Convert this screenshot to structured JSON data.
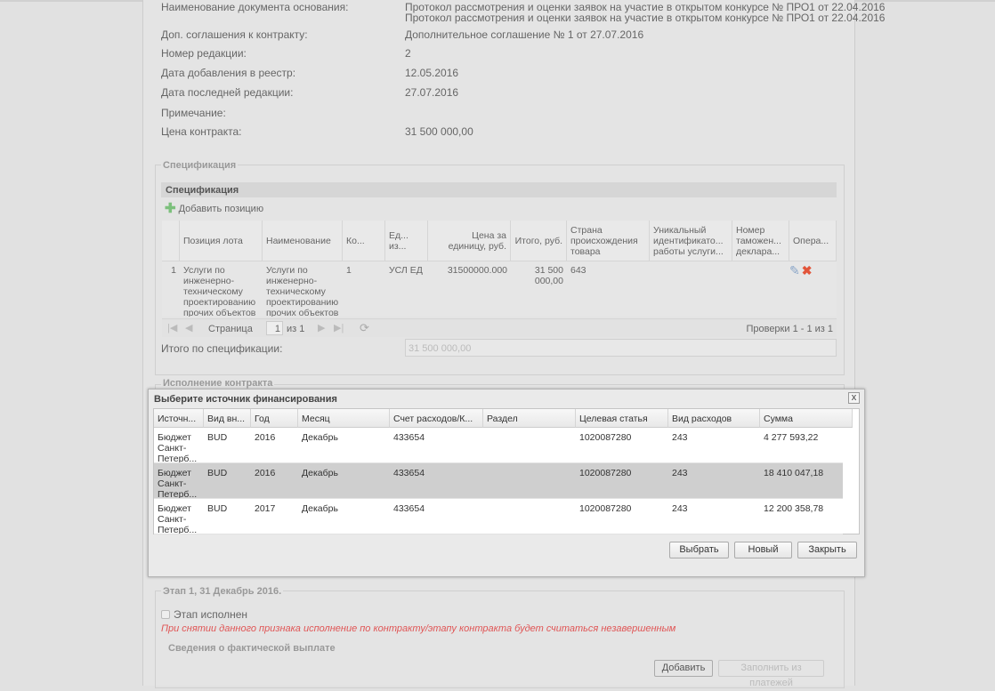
{
  "details": [
    {
      "label": "Наименование документа основания:",
      "value": [
        "Протокол рассмотрения и оценки заявок на участие в открытом конкурсе № ПРО1 от 22.04.2016",
        "Протокол рассмотрения и оценки заявок на участие в открытом конкурсе № ПРО1 от 22.04.2016"
      ]
    },
    {
      "label": "Доп. соглашения к контракту:",
      "value": [
        "Дополнительное соглашение № 1 от 27.07.2016"
      ]
    },
    {
      "label": "Номер редакции:",
      "value": [
        "2"
      ]
    },
    {
      "label": "Дата добавления в реестр:",
      "value": [
        "12.05.2016"
      ]
    },
    {
      "label": "Дата последней редакции:",
      "value": [
        "27.07.2016"
      ]
    },
    {
      "label": "Примечание:",
      "value": [
        ""
      ]
    },
    {
      "label": "Цена контракта:",
      "value": [
        "31 500 000,00"
      ]
    }
  ],
  "spec": {
    "legend": "Спецификация",
    "title": "Спецификация",
    "add_label": "Добавить позицию",
    "columns": [
      "",
      "Позиция лота",
      "Наименование",
      "Ко...",
      "Ед... из...",
      "Цена за единицу, руб.",
      "Итого, руб.",
      "Страна происхождения товара",
      "Уникальный идентификато... работы услуги...",
      "Номер таможен... деклара...",
      "Опера..."
    ],
    "rows": [
      [
        "1",
        "Услуги по инженерно-техническому проектированию прочих объектов",
        "Услуги по инженерно-техническому проектированию прочих объектов",
        "1",
        "УСЛ ЕД",
        "31500000.000",
        "31 500 000,00",
        "643",
        "",
        ""
      ]
    ],
    "pager": {
      "page_label": "Страница",
      "page": "1",
      "of": "из 1",
      "summary": "Проверки 1 - 1 из 1"
    },
    "total_label": "Итого по спецификации:",
    "total_value": "31 500 000,00"
  },
  "execution": {
    "legend": "Исполнение контракта"
  },
  "dialog": {
    "title": "Выберите источник финансирования",
    "close": "x",
    "columns": [
      "Источн...",
      "Вид вн...",
      "Год",
      "Месяц",
      "Счет расходов/К...",
      "Раздел",
      "Целевая статья",
      "Вид расходов",
      "Сумма"
    ],
    "rows": [
      [
        "Бюджет Санкт-Петерб...",
        "BUD",
        "2016",
        "Декабрь",
        "433654",
        "",
        "1020087280",
        "243",
        "4 277 593,22"
      ],
      [
        "Бюджет Санкт-Петерб...",
        "BUD",
        "2016",
        "Декабрь",
        "433654",
        "",
        "1020087280",
        "243",
        "18 410 047,18"
      ],
      [
        "Бюджет Санкт-Петерб...",
        "BUD",
        "2017",
        "Декабрь",
        "433654",
        "",
        "1020087280",
        "243",
        "12 200 358,78"
      ]
    ],
    "selected_row": 1,
    "buttons": {
      "select": "Выбрать",
      "new": "Новый",
      "close": "Закрыть"
    }
  },
  "stage": {
    "legend": "Этап 1, 31 Декабрь 2016.",
    "checkbox_label": "Этап исполнен",
    "checked": false,
    "warning": "При снятии данного признака исполнение по контракту/этапу контракта будет считаться незавершенным",
    "payments_title": "Сведения о фактической выплате",
    "add_label": "Добавить",
    "fill_label": "Заполнить из платежей"
  },
  "colors": {
    "warning": "#e05555",
    "selected_row": "#cfcfcf",
    "add_icon": "#5cb85c",
    "delete_icon": "#e2553a"
  }
}
